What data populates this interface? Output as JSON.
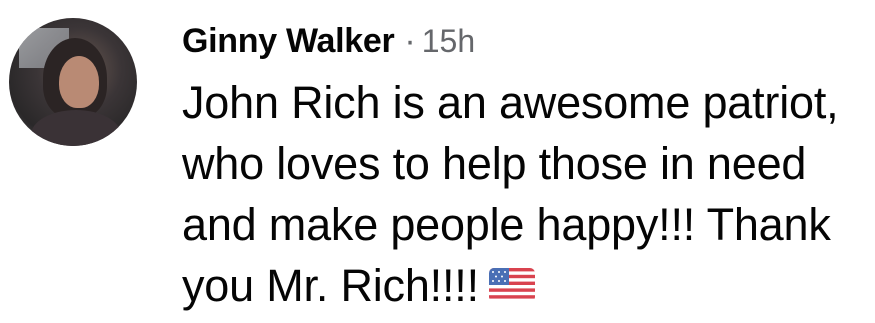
{
  "comment": {
    "author": "Ginny Walker",
    "separator": "·",
    "time": "15h",
    "text_lines": [
      "John Rich is an awesome patriot,",
      "who loves to help those in need",
      "and make people happy!!! Thank",
      "you Mr. Rich!!!!"
    ],
    "emoji": "us-flag-icon"
  }
}
